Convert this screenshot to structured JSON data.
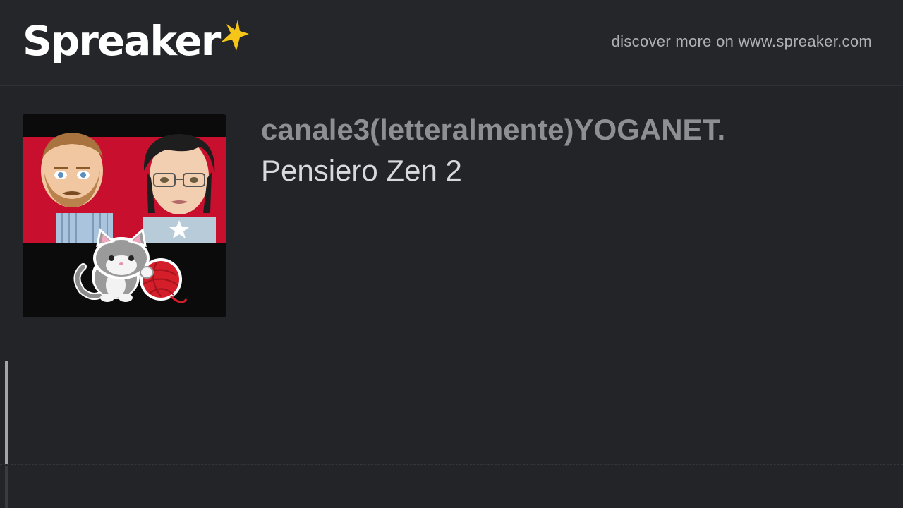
{
  "header": {
    "logo_text": "Spreaker",
    "logo_star_color": "#f5c518",
    "discover_text": "discover more on www.spreaker.com"
  },
  "episode": {
    "show_title": "canale3(letteralmente)YOGANET.",
    "episode_title": "Pensiero Zen 2",
    "cover_icon": "podcast-cover-artwork"
  },
  "player": {
    "progress": 0
  },
  "colors": {
    "background": "#232428",
    "show_title": "#8e8f93",
    "episode_title": "#d8d9dc",
    "cover_red": "#c8102e"
  }
}
